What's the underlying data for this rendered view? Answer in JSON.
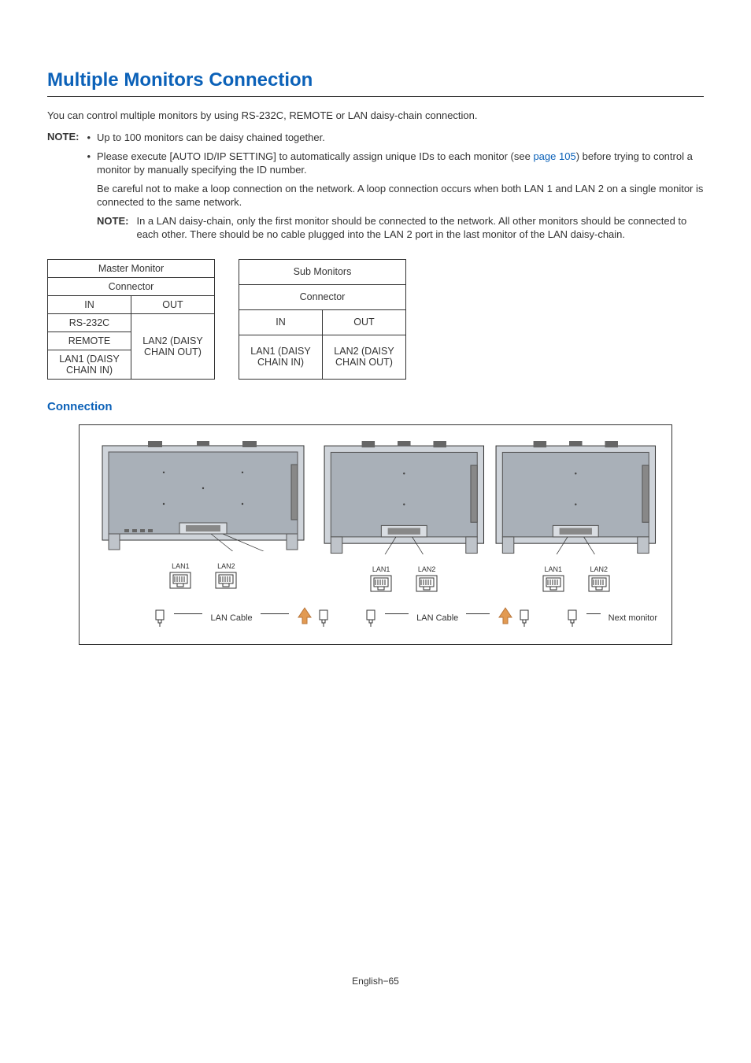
{
  "title": "Multiple Monitors Connection",
  "intro": "You can control multiple monitors by using RS-232C, REMOTE or LAN daisy-chain connection.",
  "note_label": "NOTE:",
  "bullets": {
    "b1": "Up to 100 monitors can be daisy chained together.",
    "b2_prefix": "Please execute [AUTO ID/IP SETTING] to automatically assign unique IDs to each monitor (see ",
    "b2_link": "page 105",
    "b2_suffix": ") before trying to control a monitor by manually specifying the ID number.",
    "b2_para2": "Be careful not to make a loop connection on the network. A loop connection occurs when both LAN 1 and LAN 2 on a single monitor is connected to the same network."
  },
  "inner_note_label": "NOTE:",
  "inner_note_text": "In a LAN daisy-chain, only the first monitor should be connected to the network. All other monitors should be connected to each other. There should be no cable plugged into the LAN 2 port in the last monitor of the LAN daisy-chain.",
  "tables": {
    "master_header": "Master Monitor",
    "sub_header": "Sub Monitors",
    "connector": "Connector",
    "in": "IN",
    "out": "OUT",
    "rs232c": "RS-232C",
    "remote": "REMOTE",
    "lan1": "LAN1 (DAISY CHAIN IN)",
    "lan2": "LAN2 (DAISY CHAIN OUT)"
  },
  "sub_heading": "Connection",
  "diagram": {
    "lan1": "LAN1",
    "lan2": "LAN2",
    "lan_cable": "LAN Cable",
    "next_monitor": "Next monitor"
  },
  "footer": "English−65"
}
